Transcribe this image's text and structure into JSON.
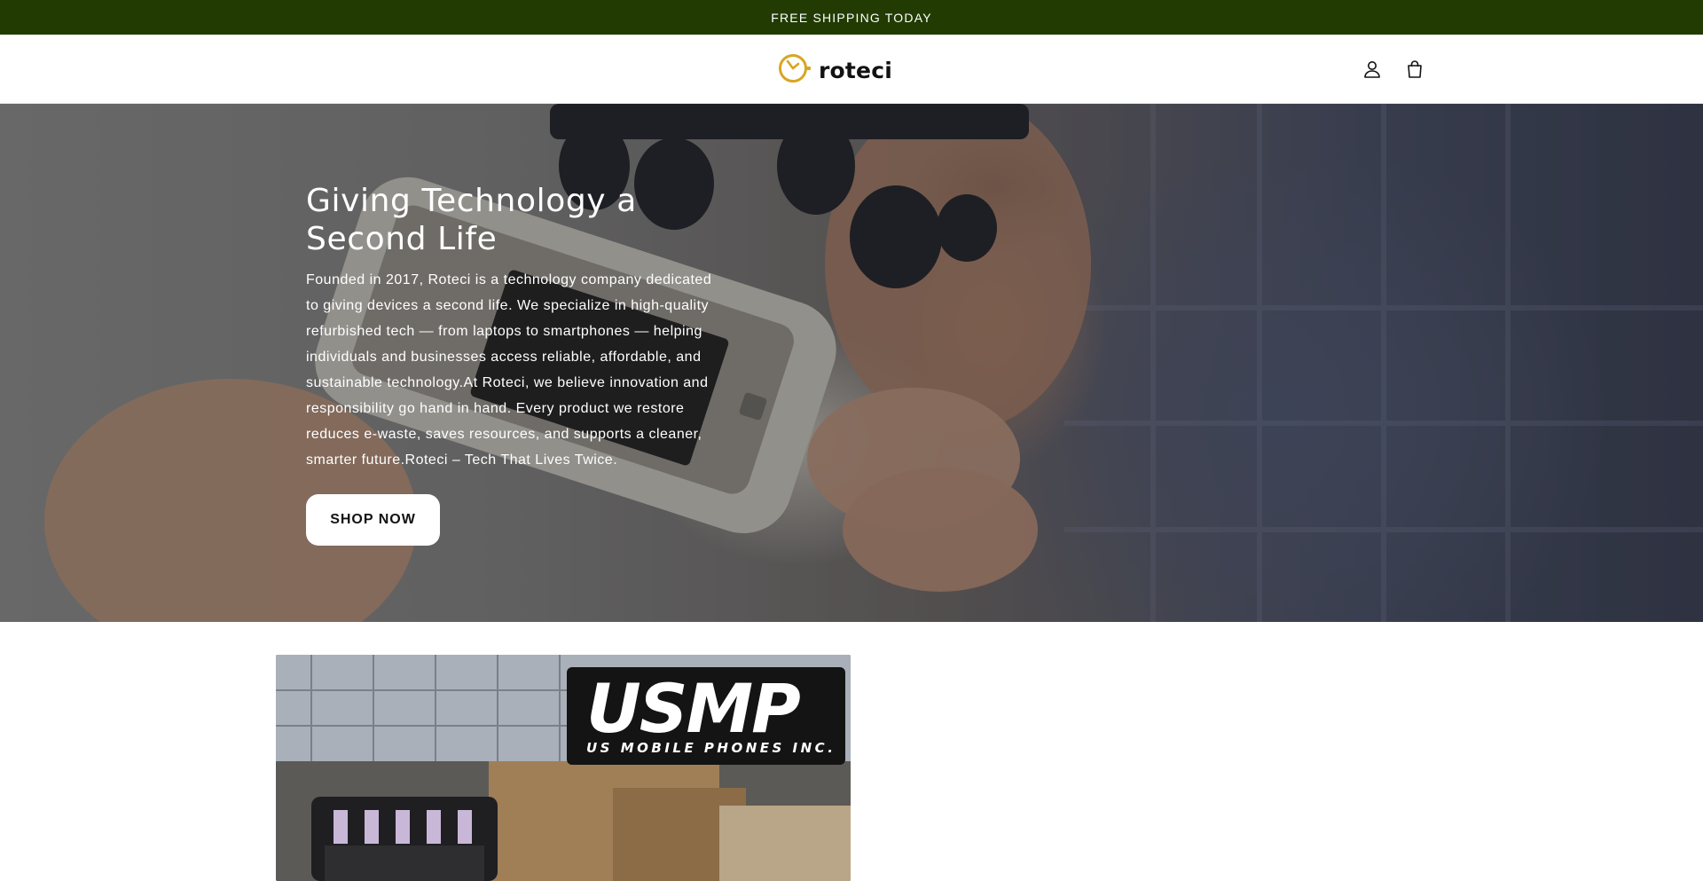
{
  "announcement": {
    "text": "FREE SHIPPING TODAY"
  },
  "header": {
    "logo_text": "roteci",
    "icons": [
      "clock-logo-icon",
      "account-icon",
      "cart-icon"
    ],
    "accent_color": "#d9a521"
  },
  "hero": {
    "title": "Giving Technology a Second Life",
    "body": "Founded in 2017, Roteci is a technology company dedicated to giving devices a second life. We specialize in high-quality refurbished tech — from laptops to smartphones — helping individuals and businesses access reliable, affordable, and sustainable technology.At Roteci, we believe innovation and responsibility go hand in hand. Every product we restore reduces e-waste, saves resources, and supports a cleaner, smarter future.Roteci – Tech That Lives Twice.",
    "cta_label": "SHOP NOW"
  },
  "brand_card": {
    "logo_main": "USMP",
    "logo_sub": "US MOBILE PHONES INC."
  },
  "colors": {
    "announcement_bg": "#213b03",
    "logo_accent": "#d9a521"
  }
}
